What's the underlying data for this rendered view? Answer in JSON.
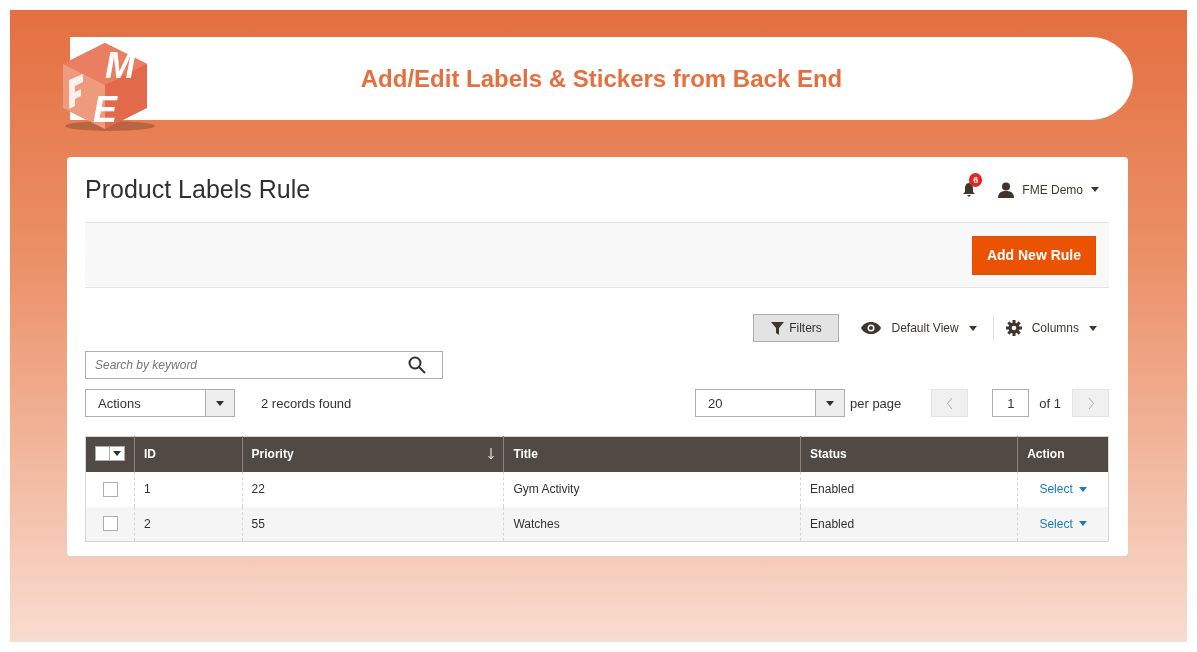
{
  "banner": {
    "logo_letters": [
      "M",
      "E"
    ],
    "title": "Add/Edit Labels & Stickers from Back End"
  },
  "page": {
    "title": "Product Labels Rule",
    "notifications": "6",
    "user": "FME Demo"
  },
  "toolbar": {
    "primary_button": "Add New Rule"
  },
  "grid_controls": {
    "filters": "Filters",
    "view": "Default View",
    "columns": "Columns",
    "search": {
      "placeholder": "Search by keyword"
    },
    "actions": "Actions",
    "records": "2 records found",
    "per_page_value": "20",
    "per_page_label": "per page",
    "page_value": "1",
    "page_total": "of 1"
  },
  "table": {
    "select_all_checked": false,
    "columns": [
      {
        "label": "ID",
        "sorted": false
      },
      {
        "label": "Priority",
        "sorted": true
      },
      {
        "label": "Title",
        "sorted": false
      },
      {
        "label": "Status",
        "sorted": false
      },
      {
        "label": "Action",
        "sorted": false
      }
    ],
    "rows": [
      {
        "selected": false,
        "cells": [
          "1",
          "22",
          "Gym Activity",
          "Enabled"
        ],
        "action": "Select"
      },
      {
        "selected": false,
        "cells": [
          "2",
          "55",
          "Watches",
          "Enabled"
        ],
        "action": "Select"
      }
    ]
  }
}
